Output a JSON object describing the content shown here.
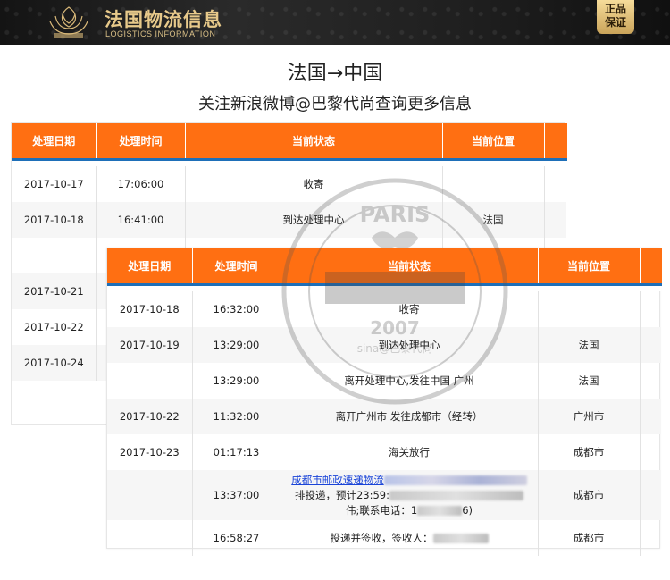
{
  "header": {
    "title": "法国物流信息",
    "subtitle": "LOGISTICS INFORMATION",
    "badge_line1": "正品",
    "badge_line2": "保证"
  },
  "route": "法国→中国",
  "follow_text": "关注新浪微博@巴黎代尚查询更多信息",
  "columns": [
    "处理日期",
    "处理时间",
    "当前状态",
    "当前位置"
  ],
  "table_back": {
    "rows": [
      {
        "date": "2017-10-17",
        "time": "17:06:00",
        "status": "收寄",
        "location": ""
      },
      {
        "date": "2017-10-18",
        "time": "16:41:00",
        "status": "到达处理中心",
        "location": "法国"
      },
      {
        "date": "",
        "time": "",
        "status": "",
        "location": ""
      },
      {
        "date": "2017-10-21",
        "time": "",
        "status": "",
        "location": ""
      },
      {
        "date": "2017-10-22",
        "time": "",
        "status": "",
        "location": ""
      },
      {
        "date": "2017-10-24",
        "time": "",
        "status": "",
        "location": ""
      }
    ]
  },
  "table_front": {
    "rows": [
      {
        "date": "2017-10-18",
        "time": "16:32:00",
        "status": "收寄",
        "location": ""
      },
      {
        "date": "2017-10-19",
        "time": "13:29:00",
        "status": "到达处理中心",
        "location": "法国"
      },
      {
        "date": "",
        "time": "13:29:00",
        "status": "离开处理中心,发往中国 广州",
        "location": "法国"
      },
      {
        "date": "2017-10-22",
        "time": "11:32:00",
        "status": "离开广州市 发往成都市（经转）",
        "location": "广州市"
      },
      {
        "date": "2017-10-23",
        "time": "01:17:13",
        "status": "海关放行",
        "location": "成都市"
      },
      {
        "date": "",
        "time": "13:37:00",
        "status_link": "成都市邮政速递物流",
        "status_line2": "排投递，预计23:59:",
        "status_line3": "伟;联系电话：1",
        "status_line3_end": "6)",
        "location": "成都市"
      },
      {
        "date": "",
        "time": "16:58:27",
        "status": "投递并签收，签收人：",
        "location": "成都市"
      }
    ]
  },
  "watermark": {
    "top_text": "PARIS",
    "year": "2007",
    "handle": "sina@巴黎代尚"
  }
}
